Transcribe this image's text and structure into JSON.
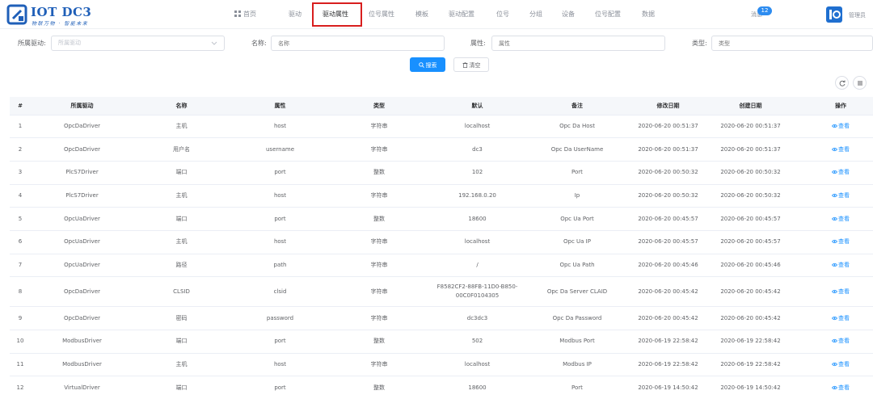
{
  "brand": {
    "title": "IOT DC3",
    "subtitle": "物联万物 · 智能未来",
    "accent": "#1f5fb8"
  },
  "nav": {
    "home": "首页",
    "items": [
      "驱动",
      "驱动属性",
      "位号属性",
      "模板",
      "驱动配置",
      "位号",
      "分组",
      "设备",
      "位号配置",
      "数据"
    ],
    "active": "驱动属性",
    "highlight_color": "#d81e1e"
  },
  "header": {
    "messages_label": "消息",
    "messages_count": "12",
    "user_name": "管理员"
  },
  "filters": {
    "driver_label": "所属驱动:",
    "driver_placeholder": "所属驱动",
    "name_label": "名称:",
    "name_placeholder": "名称",
    "attribute_label": "属性:",
    "attribute_placeholder": "属性",
    "type_label": "类型:",
    "type_placeholder": "类型"
  },
  "actions": {
    "search_label": "搜索",
    "clear_label": "清空",
    "primary_color": "#1890ff"
  },
  "table": {
    "columns": [
      "#",
      "所属驱动",
      "名称",
      "属性",
      "类型",
      "默认",
      "备注",
      "修改日期",
      "创建日期",
      "操作"
    ],
    "ops_label": "查看",
    "rows": [
      {
        "idx": "1",
        "driver": "OpcDaDriver",
        "name": "主机",
        "attr": "host",
        "type": "字符串",
        "default": "localhost",
        "remark": "Opc Da Host",
        "modified": "2020-06-20 00:51:37",
        "created": "2020-06-20 00:51:37"
      },
      {
        "idx": "2",
        "driver": "OpcDaDriver",
        "name": "用户名",
        "attr": "username",
        "type": "字符串",
        "default": "dc3",
        "remark": "Opc Da UserName",
        "modified": "2020-06-20 00:51:37",
        "created": "2020-06-20 00:51:37"
      },
      {
        "idx": "3",
        "driver": "PlcS7Driver",
        "name": "端口",
        "attr": "port",
        "type": "整数",
        "default": "102",
        "remark": "Port",
        "modified": "2020-06-20 00:50:32",
        "created": "2020-06-20 00:50:32"
      },
      {
        "idx": "4",
        "driver": "PlcS7Driver",
        "name": "主机",
        "attr": "host",
        "type": "字符串",
        "default": "192.168.0.20",
        "remark": "Ip",
        "modified": "2020-06-20 00:50:32",
        "created": "2020-06-20 00:50:32"
      },
      {
        "idx": "5",
        "driver": "OpcUaDriver",
        "name": "端口",
        "attr": "port",
        "type": "整数",
        "default": "18600",
        "remark": "Opc Ua Port",
        "modified": "2020-06-20 00:45:57",
        "created": "2020-06-20 00:45:57"
      },
      {
        "idx": "6",
        "driver": "OpcUaDriver",
        "name": "主机",
        "attr": "host",
        "type": "字符串",
        "default": "localhost",
        "remark": "Opc Ua IP",
        "modified": "2020-06-20 00:45:57",
        "created": "2020-06-20 00:45:57"
      },
      {
        "idx": "7",
        "driver": "OpcUaDriver",
        "name": "路径",
        "attr": "path",
        "type": "字符串",
        "default": "/",
        "remark": "Opc Ua Path",
        "modified": "2020-06-20 00:45:46",
        "created": "2020-06-20 00:45:46"
      },
      {
        "idx": "8",
        "driver": "OpcDaDriver",
        "name": "CLSID",
        "attr": "clsid",
        "type": "字符串",
        "default": "F8582CF2-88FB-11D0-B850-00C0F0104305",
        "remark": "Opc Da Server CLAID",
        "modified": "2020-06-20 00:45:42",
        "created": "2020-06-20 00:45:42"
      },
      {
        "idx": "9",
        "driver": "OpcDaDriver",
        "name": "密码",
        "attr": "password",
        "type": "字符串",
        "default": "dc3dc3",
        "remark": "Opc Da Password",
        "modified": "2020-06-20 00:45:42",
        "created": "2020-06-20 00:45:42"
      },
      {
        "idx": "10",
        "driver": "ModbusDriver",
        "name": "端口",
        "attr": "port",
        "type": "整数",
        "default": "502",
        "remark": "Modbus Port",
        "modified": "2020-06-19 22:58:42",
        "created": "2020-06-19 22:58:42"
      },
      {
        "idx": "11",
        "driver": "ModbusDriver",
        "name": "主机",
        "attr": "host",
        "type": "字符串",
        "default": "localhost",
        "remark": "Modbus IP",
        "modified": "2020-06-19 22:58:42",
        "created": "2020-06-19 22:58:42"
      },
      {
        "idx": "12",
        "driver": "VirtualDriver",
        "name": "端口",
        "attr": "port",
        "type": "整数",
        "default": "18600",
        "remark": "Port",
        "modified": "2020-06-19 14:50:42",
        "created": "2020-06-19 14:50:42"
      }
    ]
  }
}
